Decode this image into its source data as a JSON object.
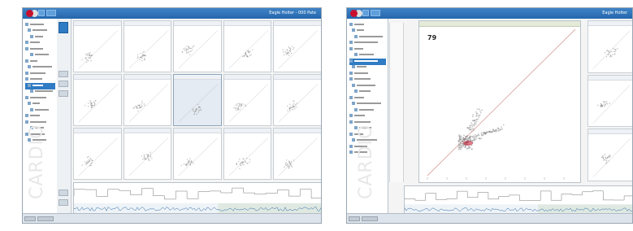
{
  "screen1": {
    "title": "Eagle Holter - 000 Pate"
  },
  "screen2": {
    "title": "Eagle Holter",
    "big_plot": {
      "value": "79"
    }
  },
  "watermark": "CARDIO",
  "colors": {
    "titlebar": "#2a6fb6",
    "selection": "#2f7bc4",
    "brand_red": "#c8102e",
    "scatter": "#8a8a8a",
    "trace_blue": "#2c6aa8"
  }
}
